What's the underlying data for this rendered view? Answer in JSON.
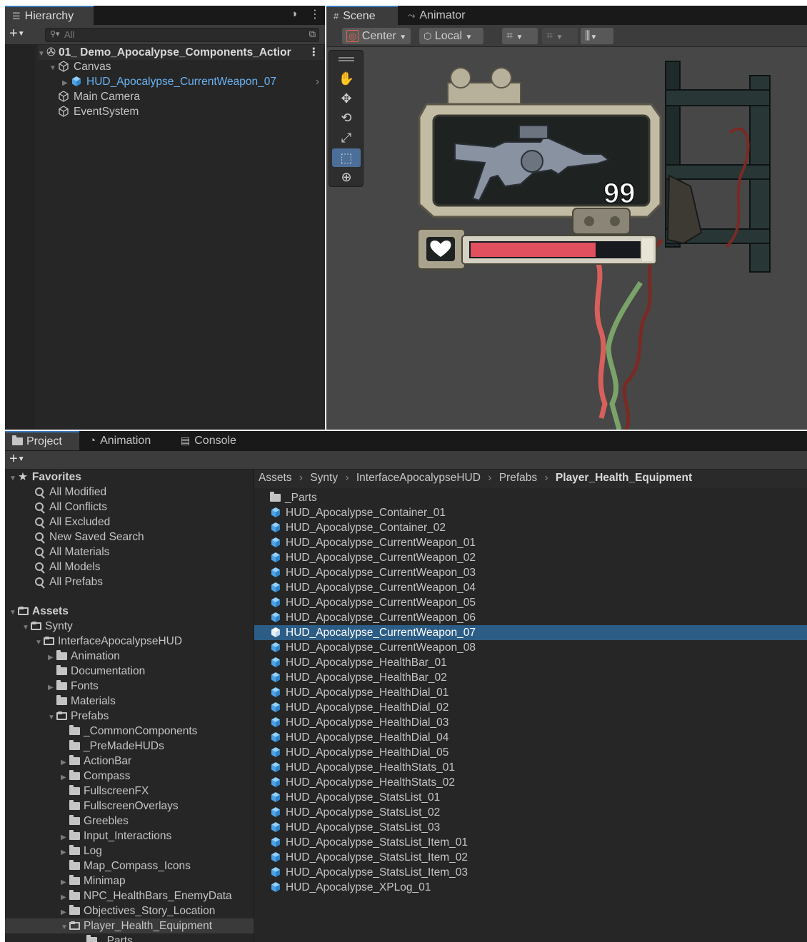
{
  "hierarchy": {
    "tab_label": "Hierarchy",
    "search_placeholder": "All",
    "items": [
      {
        "label": "01_ Demo_Apocalypse_Components_Actior"
      },
      {
        "label": "Canvas"
      },
      {
        "label": "HUD_Apocalypse_CurrentWeapon_07"
      },
      {
        "label": "Main Camera"
      },
      {
        "label": "EventSystem"
      }
    ]
  },
  "scene": {
    "tabs": [
      {
        "label": "Scene"
      },
      {
        "label": "Animator"
      }
    ],
    "pivot_label": "Center",
    "space_label": "Local",
    "ammo_count": "99",
    "health_fraction": 0.74
  },
  "bottom_tabs": [
    {
      "label": "Project"
    },
    {
      "label": "Animation"
    },
    {
      "label": "Console"
    }
  ],
  "project": {
    "favorites_label": "Favorites",
    "favorites": [
      {
        "label": "All Modified"
      },
      {
        "label": "All Conflicts"
      },
      {
        "label": "All Excluded"
      },
      {
        "label": "New Saved Search"
      },
      {
        "label": "All Materials"
      },
      {
        "label": "All Models"
      },
      {
        "label": "All Prefabs"
      }
    ],
    "assets_label": "Assets",
    "tree": [
      {
        "label": "Synty"
      },
      {
        "label": "InterfaceApocalypseHUD"
      },
      {
        "label": "Animation"
      },
      {
        "label": "Documentation"
      },
      {
        "label": "Fonts"
      },
      {
        "label": "Materials"
      },
      {
        "label": "Prefabs"
      },
      {
        "label": "_CommonComponents"
      },
      {
        "label": "_PreMadeHUDs"
      },
      {
        "label": "ActionBar"
      },
      {
        "label": "Compass"
      },
      {
        "label": "FullscreenFX"
      },
      {
        "label": "FullscreenOverlays"
      },
      {
        "label": "Greebles"
      },
      {
        "label": "Input_Interactions"
      },
      {
        "label": "Log"
      },
      {
        "label": "Map_Compass_Icons"
      },
      {
        "label": "Minimap"
      },
      {
        "label": "NPC_HealthBars_EnemyData"
      },
      {
        "label": "Objectives_Story_Location"
      },
      {
        "label": "Player_Health_Equipment"
      },
      {
        "label": "_Parts"
      }
    ],
    "breadcrumb": [
      {
        "label": "Assets"
      },
      {
        "label": "Synty"
      },
      {
        "label": "InterfaceApocalypseHUD"
      },
      {
        "label": "Prefabs"
      },
      {
        "label": "Player_Health_Equipment"
      }
    ],
    "files": [
      {
        "label": "_Parts"
      },
      {
        "label": "HUD_Apocalypse_Container_01"
      },
      {
        "label": "HUD_Apocalypse_Container_02"
      },
      {
        "label": "HUD_Apocalypse_CurrentWeapon_01"
      },
      {
        "label": "HUD_Apocalypse_CurrentWeapon_02"
      },
      {
        "label": "HUD_Apocalypse_CurrentWeapon_03"
      },
      {
        "label": "HUD_Apocalypse_CurrentWeapon_04"
      },
      {
        "label": "HUD_Apocalypse_CurrentWeapon_05"
      },
      {
        "label": "HUD_Apocalypse_CurrentWeapon_06"
      },
      {
        "label": "HUD_Apocalypse_CurrentWeapon_07"
      },
      {
        "label": "HUD_Apocalypse_CurrentWeapon_08"
      },
      {
        "label": "HUD_Apocalypse_HealthBar_01"
      },
      {
        "label": "HUD_Apocalypse_HealthBar_02"
      },
      {
        "label": "HUD_Apocalypse_HealthDial_01"
      },
      {
        "label": "HUD_Apocalypse_HealthDial_02"
      },
      {
        "label": "HUD_Apocalypse_HealthDial_03"
      },
      {
        "label": "HUD_Apocalypse_HealthDial_04"
      },
      {
        "label": "HUD_Apocalypse_HealthDial_05"
      },
      {
        "label": "HUD_Apocalypse_HealthStats_01"
      },
      {
        "label": "HUD_Apocalypse_HealthStats_02"
      },
      {
        "label": "HUD_Apocalypse_StatsList_01"
      },
      {
        "label": "HUD_Apocalypse_StatsList_02"
      },
      {
        "label": "HUD_Apocalypse_StatsList_03"
      },
      {
        "label": "HUD_Apocalypse_StatsList_Item_01"
      },
      {
        "label": "HUD_Apocalypse_StatsList_Item_02"
      },
      {
        "label": "HUD_Apocalypse_StatsList_Item_03"
      },
      {
        "label": "HUD_Apocalypse_XPLog_01"
      }
    ]
  },
  "colors": {
    "selection": "#2c5d87",
    "prefab_blue": "#6ab4f5",
    "panel": "#282828",
    "health_red": "#e0505e"
  }
}
